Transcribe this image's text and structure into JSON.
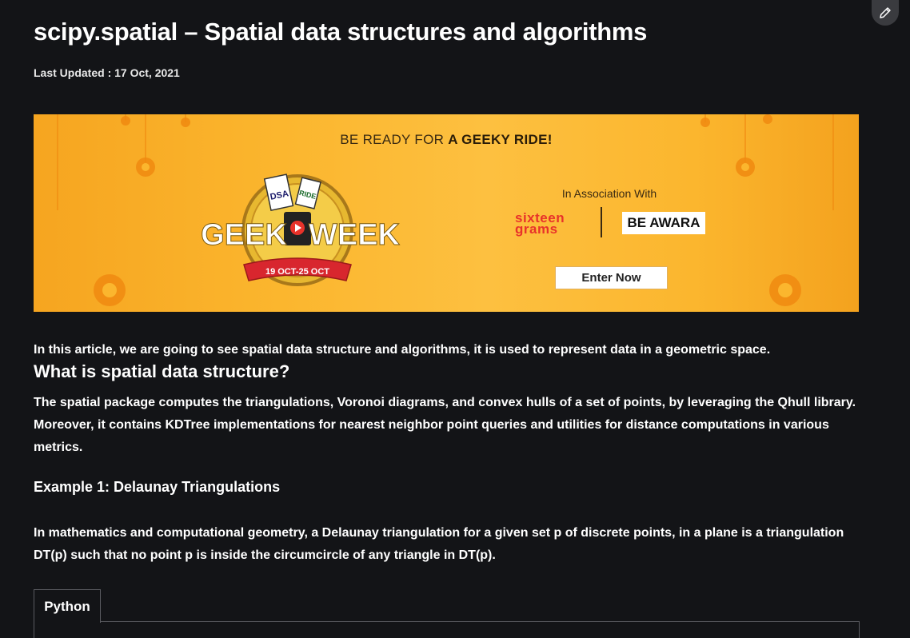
{
  "article": {
    "title": "scipy.spatial – Spatial data structures and algorithms",
    "last_updated": "Last Updated : 17 Oct, 2021",
    "intro": "In this article, we are going to see spatial data structure and algorithms, it is used to represent data in a geometric space.",
    "section_heading": "What is spatial data structure?",
    "section_text": "The spatial package computes the triangulations, Voronoi diagrams, and convex hulls of a set of points, by leveraging the Qhull library. Moreover, it contains KDTree implementations for nearest neighbor point queries and utilities for distance computations in various metrics.",
    "example_heading": "Example 1: Delaunay Triangulations",
    "example_text": "In mathematics and computational geometry, a Delaunay triangulation for a given set p of discrete points, in a plane is a triangulation DT(p) such that no point p is inside the circumcircle of any triangle in DT(p).",
    "code_tab": "Python"
  },
  "banner": {
    "headline_plain": "BE READY FOR ",
    "headline_bold": "A GEEKY RIDE!",
    "logo_word_left": "GEEK",
    "logo_word_right": "WEEK",
    "logo_dates": "19 OCT-25 OCT",
    "ticket_1": "DSA",
    "ticket_2": "RIDE",
    "association": "In Association With",
    "partner_1_line1": "sixteen",
    "partner_1_line2": "grams",
    "partner_2": "BE AWARA",
    "cta": "Enter Now"
  },
  "icons": {
    "edit": "pencil-icon"
  },
  "colors": {
    "background": "#131417",
    "banner_orange": "#fbb62e",
    "ribbon_red": "#d8262e",
    "partner_red": "#e8322a"
  }
}
